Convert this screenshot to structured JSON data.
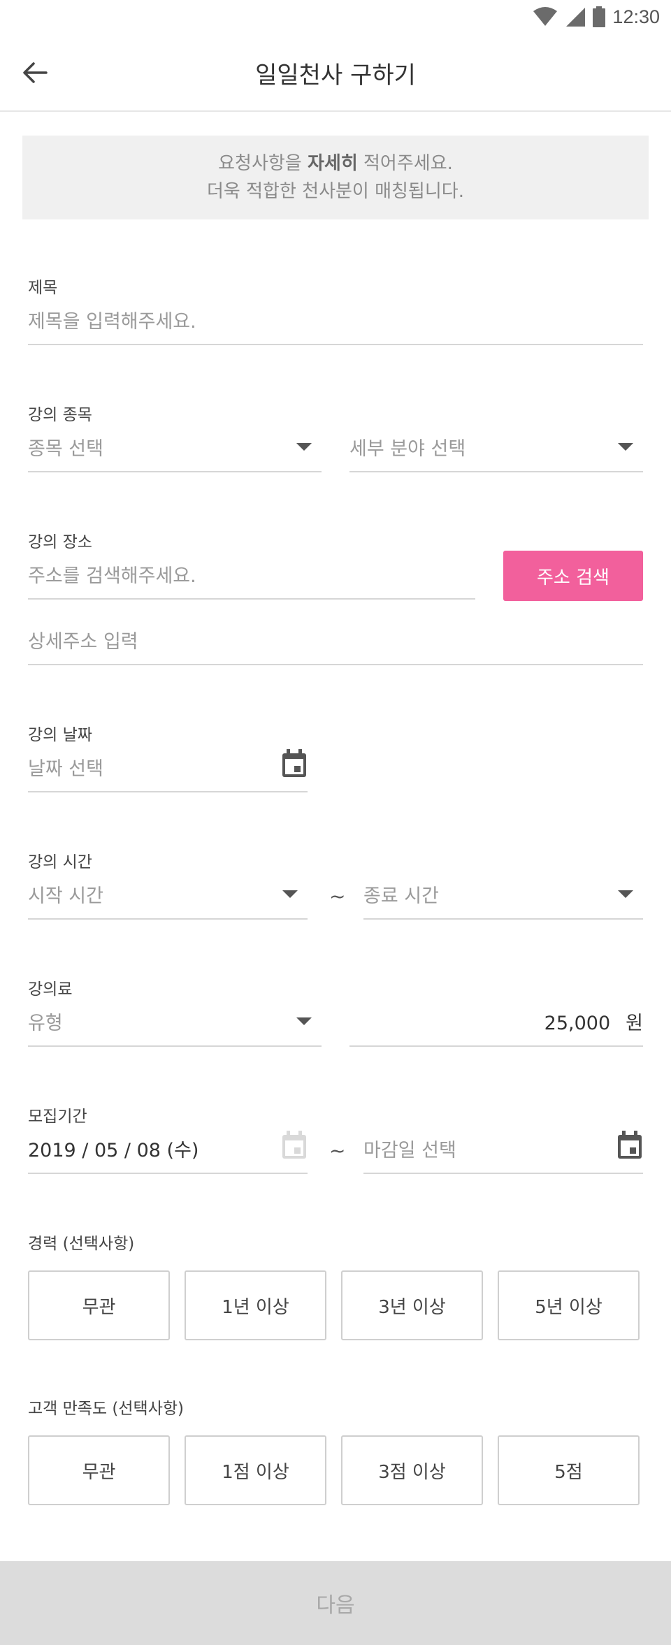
{
  "status": {
    "time": "12:30"
  },
  "header": {
    "title": "일일천사 구하기"
  },
  "notice": {
    "line1_pre": "요청사항을 ",
    "line1_bold": "자세히",
    "line1_post": " 적어주세요.",
    "line2": "더욱 적합한 천사분이 매칭됩니다."
  },
  "title_section": {
    "label": "제목",
    "placeholder": "제목을 입력해주세요."
  },
  "category": {
    "label": "강의 종목",
    "main_placeholder": "종목 선택",
    "sub_placeholder": "세부 분야 선택"
  },
  "location": {
    "label": "강의 장소",
    "address_placeholder": "주소를 검색해주세요.",
    "search_button": "주소 검색",
    "detail_placeholder": "상세주소 입력"
  },
  "date": {
    "label": "강의 날짜",
    "placeholder": "날짜 선택"
  },
  "time": {
    "label": "강의 시간",
    "start_placeholder": "시작 시간",
    "separator": "~",
    "end_placeholder": "종료 시간"
  },
  "fee": {
    "label": "강의료",
    "type_placeholder": "유형",
    "amount": "25,000",
    "unit": "원"
  },
  "recruit": {
    "label": "모집기간",
    "start_value": "2019 / 05 / 08 (수)",
    "separator": "~",
    "end_placeholder": "마감일 선택"
  },
  "career": {
    "label": "경력 (선택사항)",
    "options": [
      "무관",
      "1년 이상",
      "3년 이상",
      "5년 이상"
    ]
  },
  "satisfaction": {
    "label": "고객 만족도 (선택사항)",
    "options": [
      "무관",
      "1점 이상",
      "3점 이상",
      "5점"
    ]
  },
  "footer": {
    "next_button": "다음"
  },
  "colors": {
    "accent": "#f2609c",
    "disabled_bg": "#dcdcdc",
    "notice_bg": "#f0f0f0"
  },
  "icons": [
    "wifi-icon",
    "signal-icon",
    "battery-icon",
    "back-arrow-icon",
    "dropdown-arrow-icon",
    "calendar-icon"
  ]
}
